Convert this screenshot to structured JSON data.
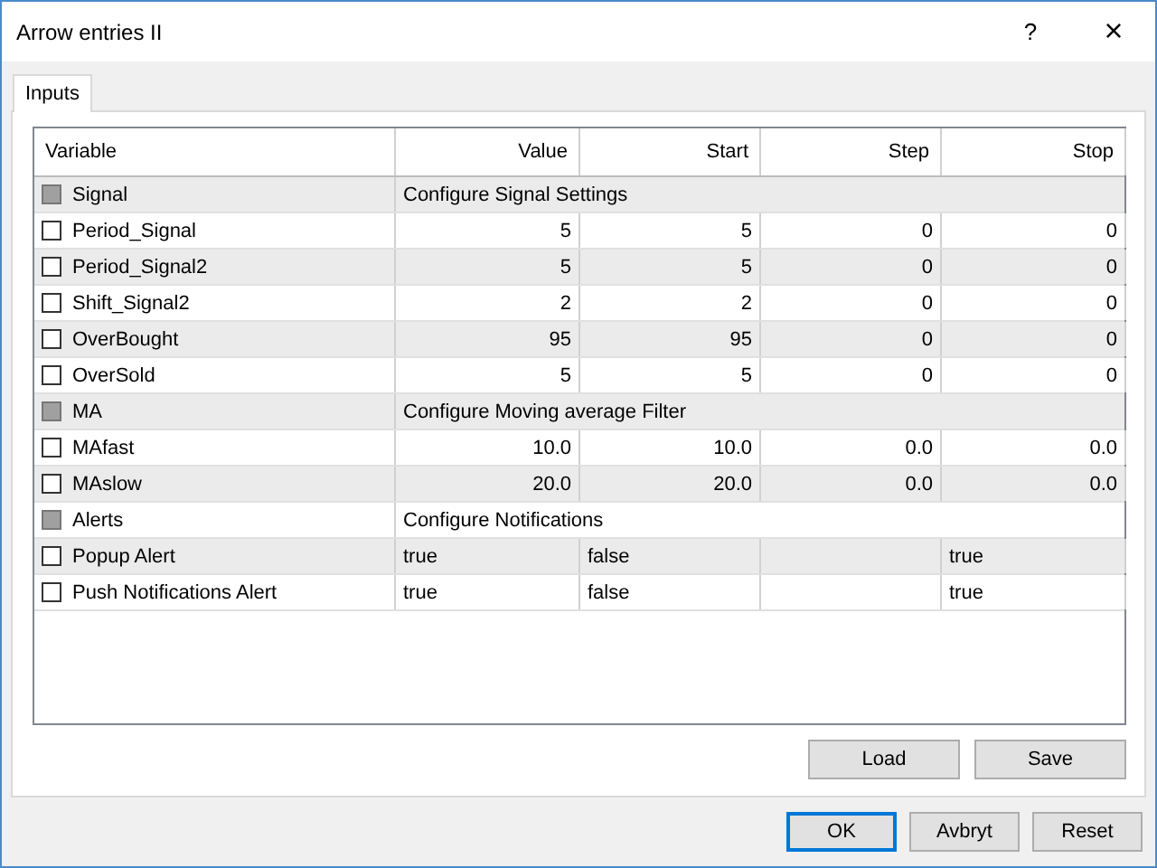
{
  "window": {
    "title": "Arrow entries II",
    "help": "?",
    "close": "×"
  },
  "tabs": [
    {
      "label": "Inputs",
      "selected": true
    }
  ],
  "table": {
    "columns": [
      "Variable",
      "Value",
      "Start",
      "Step",
      "Stop"
    ],
    "rows": [
      {
        "kind": "group",
        "checked": false,
        "name": "Signal",
        "description": "Configure Signal Settings"
      },
      {
        "kind": "number",
        "checked": false,
        "name": "Period_Signal",
        "value": "5",
        "start": "5",
        "step": "0",
        "stop": "0"
      },
      {
        "kind": "number",
        "checked": false,
        "name": "Period_Signal2",
        "value": "5",
        "start": "5",
        "step": "0",
        "stop": "0"
      },
      {
        "kind": "number",
        "checked": false,
        "name": "Shift_Signal2",
        "value": "2",
        "start": "2",
        "step": "0",
        "stop": "0"
      },
      {
        "kind": "number",
        "checked": false,
        "name": "OverBought",
        "value": "95",
        "start": "95",
        "step": "0",
        "stop": "0"
      },
      {
        "kind": "number",
        "checked": false,
        "name": "OverSold",
        "value": "5",
        "start": "5",
        "step": "0",
        "stop": "0"
      },
      {
        "kind": "group",
        "checked": false,
        "name": "MA",
        "description": "Configure Moving average Filter"
      },
      {
        "kind": "number",
        "checked": false,
        "name": "MAfast",
        "value": "10.0",
        "start": "10.0",
        "step": "0.0",
        "stop": "0.0"
      },
      {
        "kind": "number",
        "checked": false,
        "name": "MAslow",
        "value": "20.0",
        "start": "20.0",
        "step": "0.0",
        "stop": "0.0"
      },
      {
        "kind": "group",
        "checked": false,
        "name": "Alerts",
        "description": "Configure Notifications"
      },
      {
        "kind": "text",
        "checked": false,
        "name": "Popup Alert",
        "value": "true",
        "start": "false",
        "stop": "true"
      },
      {
        "kind": "text",
        "checked": false,
        "name": "Push Notifications Alert",
        "value": "true",
        "start": "false",
        "stop": "true"
      }
    ]
  },
  "panel_buttons": [
    "Load",
    "Save"
  ],
  "dialog_buttons": [
    {
      "label": "OK",
      "default": true
    },
    {
      "label": "Avbryt",
      "default": false
    },
    {
      "label": "Reset",
      "default": false
    }
  ]
}
